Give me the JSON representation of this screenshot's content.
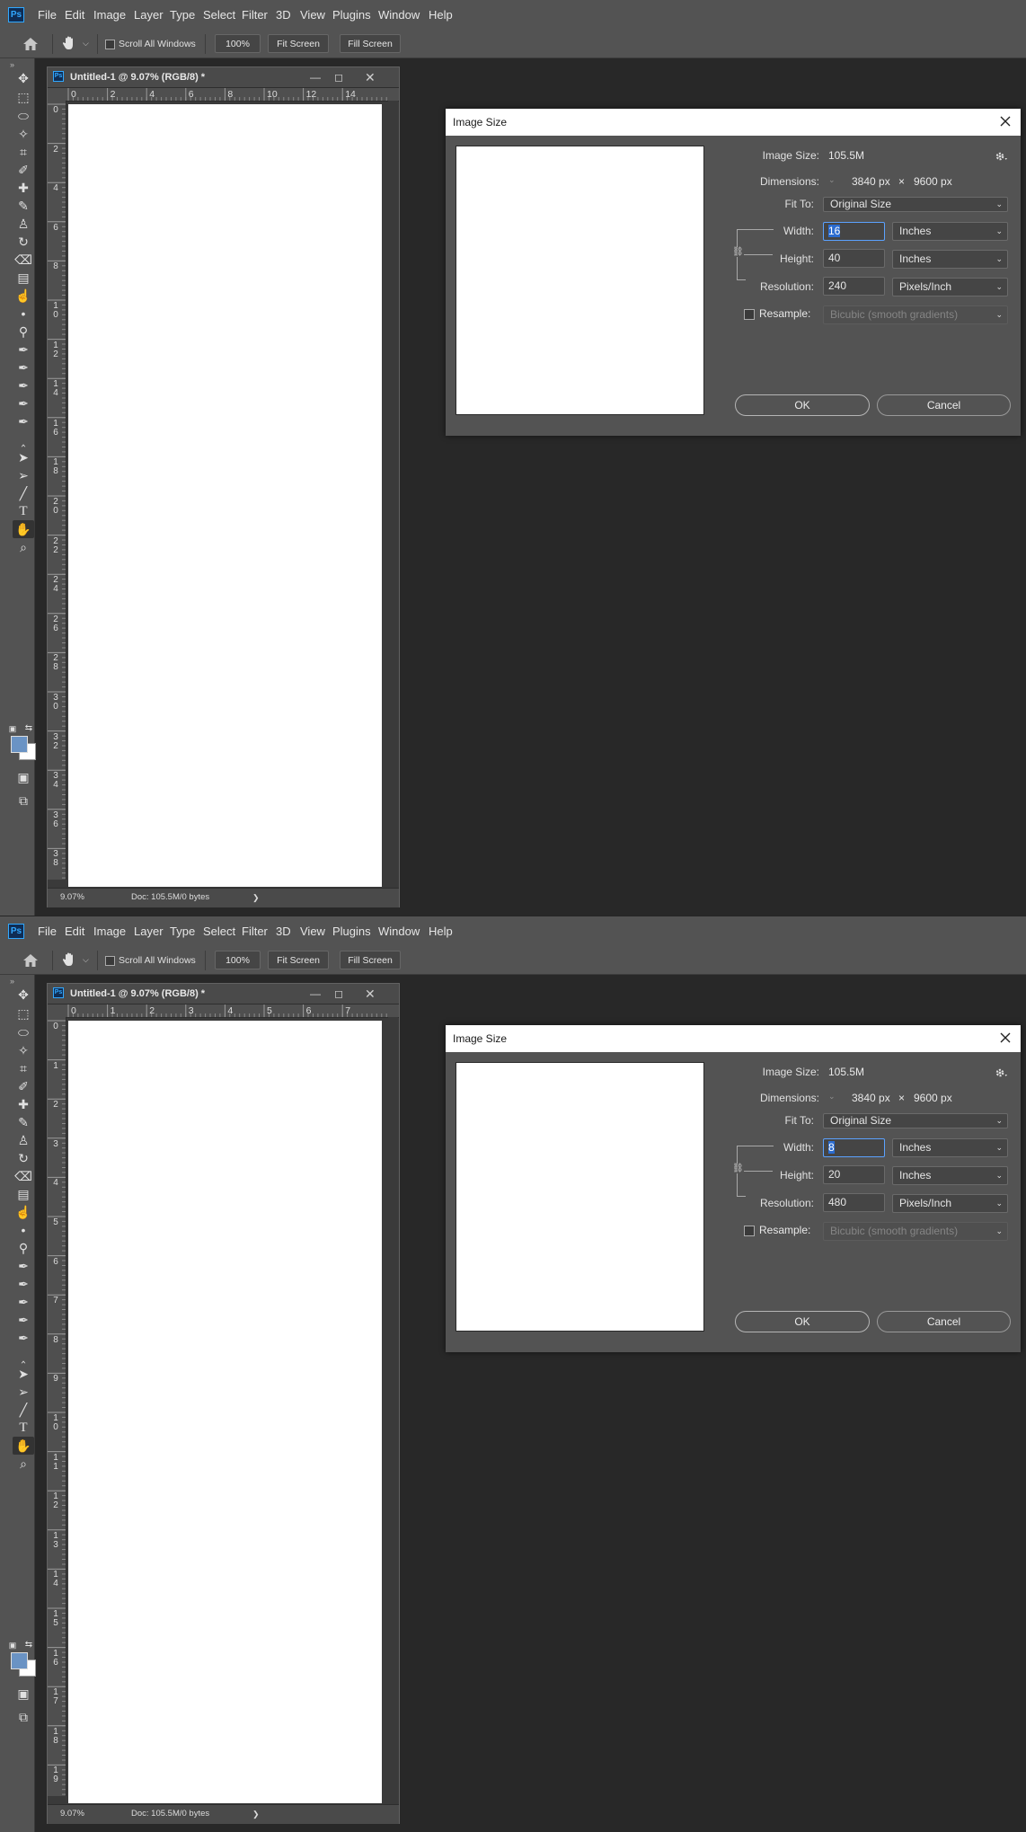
{
  "app": {
    "logo": "Ps",
    "menu": [
      "File",
      "Edit",
      "Image",
      "Layer",
      "Type",
      "Select",
      "Filter",
      "3D",
      "View",
      "Plugins",
      "Window",
      "Help"
    ],
    "options": {
      "scroll_all_windows": "Scroll All Windows",
      "zoom_100": "100%",
      "fit_screen": "Fit Screen",
      "fill_screen": "Fill Screen"
    },
    "colors": {
      "foreground": "#6a93c4",
      "background": "#ffffff",
      "accent": "#31a8ff"
    },
    "tools": [
      "move-icon",
      "marquee-icon",
      "lasso-icon",
      "magic-wand-icon",
      "crop-icon",
      "eyedropper-icon",
      "healing-brush-icon",
      "brush-icon",
      "clone-stamp-icon",
      "history-brush-icon",
      "eraser-icon",
      "gradient-icon",
      "smudge-icon",
      "blur-icon",
      "dodge-icon",
      "pen-icon",
      "freeform-pen-icon",
      "curvature-pen-icon",
      "add-anchor-icon",
      "delete-anchor-icon",
      "convert-point-icon",
      "path-selection-icon",
      "direct-selection-icon",
      "line-icon",
      "type-icon",
      "hand-icon",
      "zoom-icon"
    ]
  },
  "shot1": {
    "doc_title": "Untitled-1 @ 9.07% (RGB/8) *",
    "hruler": [
      "0",
      "2",
      "4",
      "6",
      "8",
      "10",
      "12",
      "14"
    ],
    "vruler": [
      "0",
      "2",
      "4",
      "6",
      "8",
      "10",
      "12",
      "14",
      "16",
      "18",
      "20",
      "22",
      "24",
      "26",
      "28",
      "30",
      "32",
      "34",
      "36",
      "38"
    ],
    "status_zoom": "9.07%",
    "status_doc": "Doc: 105.5M/0 bytes",
    "dialog": {
      "title": "Image Size",
      "image_size_label": "Image Size:",
      "image_size_value": "105.5M",
      "dimensions_label": "Dimensions:",
      "dim_w": "3840 px",
      "dim_x": "×",
      "dim_h": "9600 px",
      "fit_to_label": "Fit To:",
      "fit_to_value": "Original Size",
      "width_label": "Width:",
      "width_value": "16",
      "width_unit": "Inches",
      "height_label": "Height:",
      "height_value": "40",
      "height_unit": "Inches",
      "resolution_label": "Resolution:",
      "resolution_value": "240",
      "resolution_unit": "Pixels/Inch",
      "resample_label": "Resample:",
      "resample_value": "Bicubic (smooth gradients)",
      "ok": "OK",
      "cancel": "Cancel"
    }
  },
  "shot2": {
    "doc_title": "Untitled-1 @ 9.07% (RGB/8) *",
    "hruler": [
      "0",
      "1",
      "2",
      "3",
      "4",
      "5",
      "6",
      "7"
    ],
    "vruler": [
      "0",
      "1",
      "2",
      "3",
      "4",
      "5",
      "6",
      "7",
      "8",
      "9",
      "10",
      "11",
      "12",
      "13",
      "14",
      "15",
      "16",
      "17",
      "18",
      "19"
    ],
    "status_zoom": "9.07%",
    "status_doc": "Doc: 105.5M/0 bytes",
    "dialog": {
      "title": "Image Size",
      "image_size_label": "Image Size:",
      "image_size_value": "105.5M",
      "dimensions_label": "Dimensions:",
      "dim_w": "3840 px",
      "dim_x": "×",
      "dim_h": "9600 px",
      "fit_to_label": "Fit To:",
      "fit_to_value": "Original Size",
      "width_label": "Width:",
      "width_value": "8",
      "width_unit": "Inches",
      "height_label": "Height:",
      "height_value": "20",
      "height_unit": "Inches",
      "resolution_label": "Resolution:",
      "resolution_value": "480",
      "resolution_unit": "Pixels/Inch",
      "resample_label": "Resample:",
      "resample_value": "Bicubic (smooth gradients)",
      "ok": "OK",
      "cancel": "Cancel"
    }
  }
}
